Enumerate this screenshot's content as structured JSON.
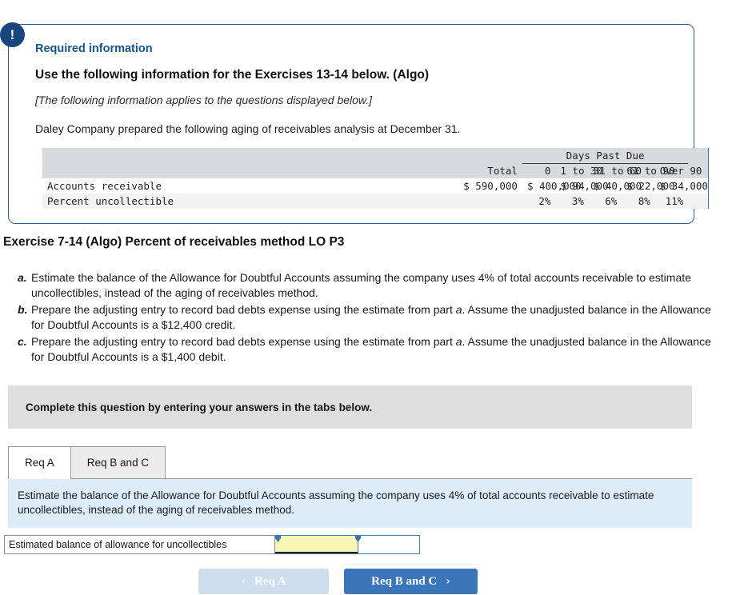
{
  "info_panel": {
    "badge_icon": "exclamation-icon",
    "badge_glyph": "!",
    "required_label": "Required information",
    "heading": "Use the following information for the Exercises 13-14 below. (Algo)",
    "applies_note": "[The following information applies to the questions displayed below.]",
    "intro": "Daley Company prepared the following aging of receivables analysis at December 31.",
    "accent_color": "#14558f",
    "border_color": "#2c5d94"
  },
  "aging_table": {
    "group_header": "Days Past Due",
    "columns": [
      "",
      "Total",
      "0",
      "1 to 30",
      "31 to 60",
      "61 to 90",
      "Over 90"
    ],
    "rows": [
      {
        "label": "Accounts receivable",
        "values": [
          "$ 590,000",
          "$ 400,000",
          "$ 94,000",
          "$ 40,000",
          "$ 22,000",
          "$ 34,000"
        ]
      },
      {
        "label": "Percent uncollectible",
        "values": [
          "",
          "2%",
          "3%",
          "6%",
          "8%",
          "11%"
        ]
      }
    ]
  },
  "exercise": {
    "title": "Exercise 7-14 (Algo) Percent of receivables method LO P3",
    "requirements": [
      {
        "letter": "a.",
        "text": "Estimate the balance of the Allowance for Doubtful Accounts assuming the company uses 4% of total accounts receivable to estimate uncollectibles, instead of the aging of receivables method."
      },
      {
        "letter": "b.",
        "text_1": "Prepare the adjusting entry to record bad debts expense using the estimate from part ",
        "text_em": "a",
        "text_2": ". Assume the unadjusted balance in the Allowance for Doubtful Accounts is a $12,400 credit."
      },
      {
        "letter": "c.",
        "text_1": "Prepare the adjusting entry to record bad debts expense using the estimate from part ",
        "text_em": "a",
        "text_2": ". Assume the unadjusted balance in the Allowance for Doubtful Accounts is a $1,400 debit."
      }
    ]
  },
  "complete_bar": {
    "text": "Complete this question by entering your answers in the tabs below."
  },
  "tabs": [
    {
      "label": "Req A",
      "active": true
    },
    {
      "label": "Req B and C",
      "active": false
    }
  ],
  "blue_instruction": {
    "text": "Estimate the balance of the Allowance for Doubtful Accounts assuming the company uses 4% of total accounts receivable to estimate uncollectibles, instead of the aging of receivables method.",
    "background_color": "#ddecf9"
  },
  "answer_row": {
    "label": "Estimated balance of allowance for uncollectibles",
    "input_value": "",
    "input_placeholder": "",
    "cell_color": "#f7f6b4"
  },
  "nav": {
    "prev_label": "Req A",
    "prev_chevron": "‹",
    "next_label": "Req B and C",
    "next_chevron": "›",
    "prev_color": "#cfdeee",
    "next_color": "#3b77b8"
  }
}
